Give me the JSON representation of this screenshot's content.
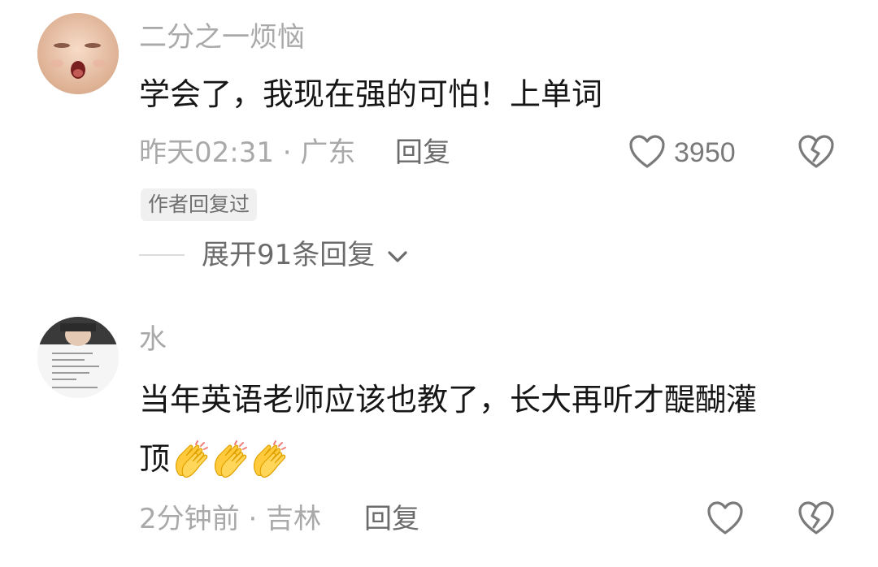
{
  "comments": [
    {
      "username": "二分之一烦恼",
      "text": "学会了，我现在强的可怕！上单词",
      "time_location": "昨天02:31 · 广东",
      "reply_label": "回复",
      "like_count": "3950",
      "author_badge": "作者回复过",
      "expand_label": "展开91条回复",
      "avatar_icon": "baby-face-avatar"
    },
    {
      "username": "水",
      "text_line1": "当年英语老师应该也教了，长大再听才醍醐灌",
      "text_line2": "顶",
      "emoji": "clapping-hands",
      "time_location": "2分钟前 · 吉林",
      "reply_label": "回复",
      "avatar_icon": "photo-avatar"
    }
  ],
  "colors": {
    "background": "#ffffff",
    "username": "#a9a9a9",
    "content": "#161616",
    "meta": "#a9a9a9",
    "badge_bg": "#f0f0f0"
  }
}
